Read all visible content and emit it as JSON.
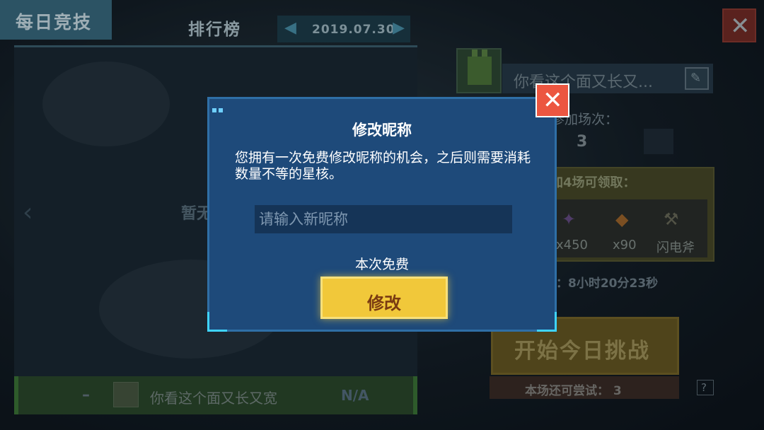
{
  "header": {
    "tab_label": "每日竞技",
    "rank_title": "排行榜",
    "date": "2019.07.30",
    "prev_icon": "triangle-left-icon",
    "next_icon": "triangle-right-icon"
  },
  "leaderboard": {
    "empty_text": "暂无数据",
    "self_row": {
      "rank": "–",
      "name": "你看这个面又长又宽",
      "score": "N/A"
    }
  },
  "profile": {
    "name": "你看这个面又长又...",
    "join_label": "已参加场次：",
    "join_count": "3"
  },
  "rewards": {
    "title": "再参加4场可领取：",
    "items": [
      {
        "icon": "star-core-icon",
        "label": "x450"
      },
      {
        "icon": "diamond-icon",
        "label": "x90"
      },
      {
        "icon": "axe-icon",
        "label": "闪电斧"
      }
    ]
  },
  "timer": {
    "text": "剩余时间：8小时20分23秒"
  },
  "start": {
    "button_label": "开始今日挑战",
    "tries_text": "本场还可尝试：  3",
    "help_label": "?"
  },
  "dialog": {
    "title": "修改昵称",
    "description": "您拥有一次免费修改昵称的机会，之后则需要消耗数量不等的星核。",
    "input_placeholder": "请输入新昵称",
    "input_value": "",
    "free_text": "本次免费",
    "confirm_label": "修改",
    "close_glyph": "✕"
  },
  "colors": {
    "dialog_bg": "#1e4a7a",
    "confirm_button": "#f1c83a",
    "close_button": "#ec5640",
    "accent": "#3fd4ff"
  }
}
